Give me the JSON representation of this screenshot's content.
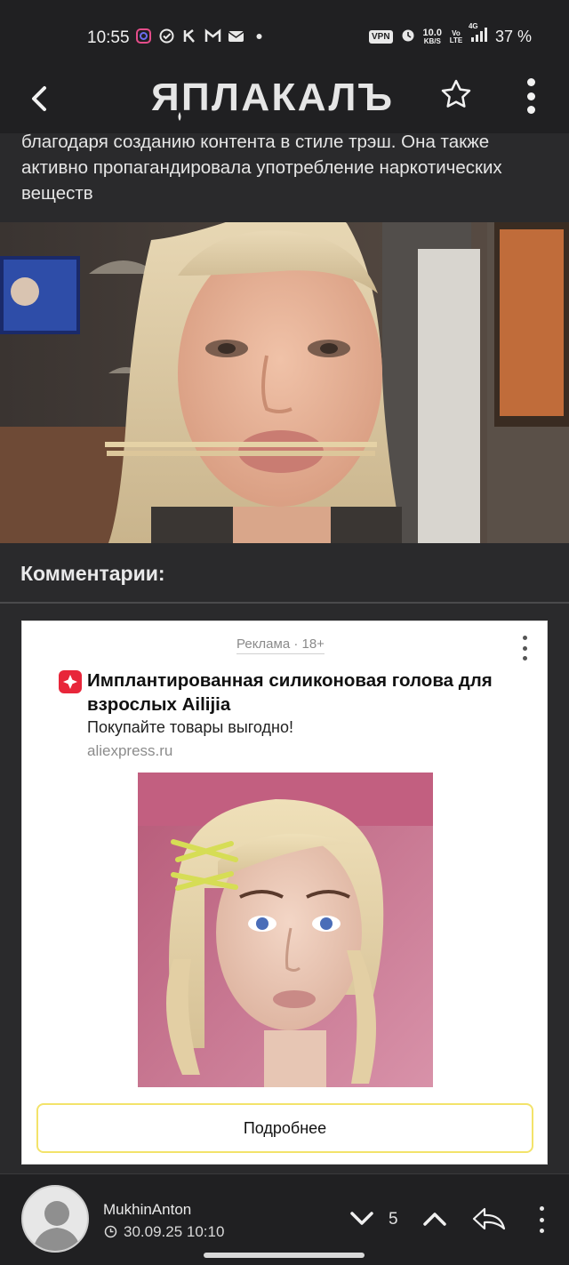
{
  "status_bar": {
    "time": "10:55",
    "vpn": "VPN",
    "net_speed": "10.0",
    "net_unit": "KB/S",
    "volte": "Vo LTE",
    "network": "4G",
    "battery": "37 %",
    "notification_icons": [
      "instagram-icon",
      "check-circle-icon",
      "k-icon",
      "gmail-icon",
      "mail-icon",
      "dot-icon"
    ]
  },
  "header": {
    "logo_text": "ЯПЛАКАЛЪ",
    "colors": {
      "bar": "#202022",
      "logo": "#e6e6e6"
    }
  },
  "article": {
    "text": "благодаря созданию контента в стиле трэш. Она также активно пропагандировала употребление наркотических веществ"
  },
  "comments": {
    "title": "Комментарии:"
  },
  "ad": {
    "label": "Реклама · 18+",
    "title": "Имплантированная силиконовая голова для взрослых Ailijia",
    "subtitle": "Покупайте товары выгодно!",
    "domain": "aliexpress.ru",
    "button": "Подробнее",
    "colors": {
      "brand": "#e8263a",
      "button_border": "#f3e36a"
    }
  },
  "comment_bar": {
    "username": "MukhinAnton",
    "datetime": "30.09.25 10:10",
    "votes": "5"
  }
}
